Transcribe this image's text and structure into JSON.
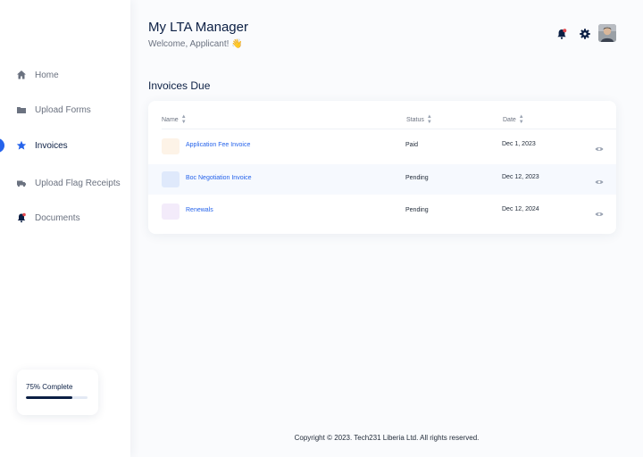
{
  "app": {
    "title": "My LTA Manager",
    "welcome": "Welcome, Applicant! 👋"
  },
  "sidebar": {
    "items": [
      {
        "label": "Home",
        "icon": "home-icon",
        "active": false
      },
      {
        "label": "Upload Forms",
        "icon": "folder-icon",
        "active": false
      },
      {
        "label": "Invoices",
        "icon": "star-icon",
        "active": true
      },
      {
        "label": "Upload Flag Receipts",
        "icon": "truck-icon",
        "active": false
      },
      {
        "label": "Documents",
        "icon": "bell-icon",
        "active": false
      }
    ],
    "progress": {
      "label": "75% Complete",
      "fraction": 0.75
    }
  },
  "header": {
    "icons": [
      "notification-bell-icon",
      "gear-icon",
      "user-avatar"
    ]
  },
  "invoices": {
    "section_title": "Invoices Due",
    "columns": {
      "name": "Name",
      "status": "Status",
      "date": "Date"
    },
    "rows": [
      {
        "name": "Application Fee Invoice",
        "status": "Paid",
        "date": "Dec 1, 2023",
        "thumb_color": "#fdf3e7"
      },
      {
        "name": "Boc Negotiation Invoice",
        "status": "Pending",
        "date": "Dec 12, 2023",
        "thumb_color": "#dfe9fb"
      },
      {
        "name": "Renewals",
        "status": "Pending",
        "date": "Dec 12, 2024",
        "thumb_color": "#f3ebfa"
      }
    ]
  },
  "footer": {
    "text": "Copyright © 2023. Tech231 Liberia Ltd. All rights reserved."
  },
  "colors": {
    "accent": "#2563eb",
    "navy": "#0b1f44",
    "notification": "#e5484d"
  }
}
